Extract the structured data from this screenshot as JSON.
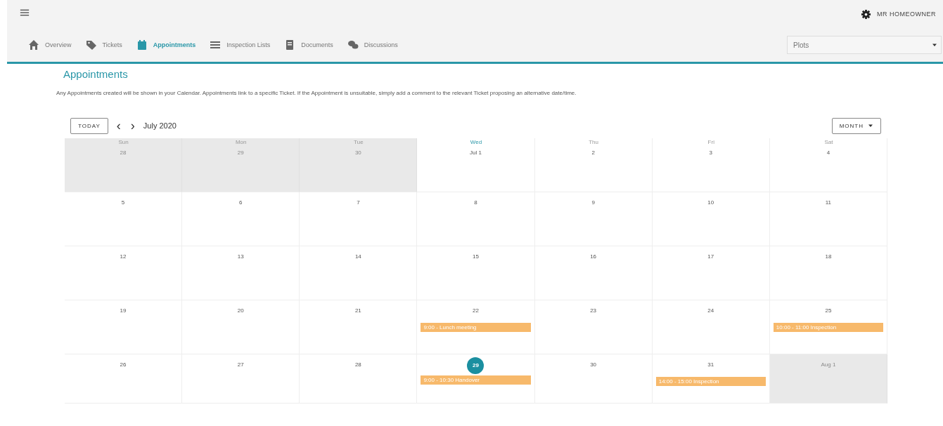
{
  "user": {
    "name": "MR HOMEOWNER"
  },
  "tabs": [
    {
      "label": "Overview",
      "selected": false
    },
    {
      "label": "Tickets",
      "selected": false
    },
    {
      "label": "Appointments",
      "selected": true
    },
    {
      "label": "Inspection Lists",
      "selected": false
    },
    {
      "label": "Documents",
      "selected": false
    },
    {
      "label": "Discussions",
      "selected": false
    }
  ],
  "plot_select": {
    "placeholder": "Plots"
  },
  "page": {
    "title": "Appointments",
    "description": "Any Appointments created will be shown in your Calendar. Appointments link to a specific Ticket. If the Appointment is unsuitable, simply add a comment to the relevant Ticket proposing an alternative date/time."
  },
  "calendar": {
    "today_button": "TODAY",
    "prev": "‹",
    "next": "›",
    "period": "July 2020",
    "view_button": "MONTH",
    "weekdays": [
      {
        "label": "Sun",
        "today": false
      },
      {
        "label": "Mon",
        "today": false
      },
      {
        "label": "Tue",
        "today": false
      },
      {
        "label": "Wed",
        "today": true
      },
      {
        "label": "Thu",
        "today": false
      },
      {
        "label": "Fri",
        "today": false
      },
      {
        "label": "Sat",
        "today": false
      }
    ],
    "weeks": [
      [
        {
          "label": "28",
          "other_month": true,
          "today": false
        },
        {
          "label": "29",
          "other_month": true,
          "today": false
        },
        {
          "label": "30",
          "other_month": true,
          "today": false
        },
        {
          "label": "Jul 1",
          "other_month": false,
          "today": false
        },
        {
          "label": "2",
          "other_month": false,
          "today": false
        },
        {
          "label": "3",
          "other_month": false,
          "today": false
        },
        {
          "label": "4",
          "other_month": false,
          "today": false
        }
      ],
      [
        {
          "label": "5",
          "other_month": false,
          "today": false
        },
        {
          "label": "6",
          "other_month": false,
          "today": false
        },
        {
          "label": "7",
          "other_month": false,
          "today": false
        },
        {
          "label": "8",
          "other_month": false,
          "today": false
        },
        {
          "label": "9",
          "other_month": false,
          "today": false
        },
        {
          "label": "10",
          "other_month": false,
          "today": false
        },
        {
          "label": "11",
          "other_month": false,
          "today": false
        }
      ],
      [
        {
          "label": "12",
          "other_month": false,
          "today": false
        },
        {
          "label": "13",
          "other_month": false,
          "today": false
        },
        {
          "label": "14",
          "other_month": false,
          "today": false
        },
        {
          "label": "15",
          "other_month": false,
          "today": false
        },
        {
          "label": "16",
          "other_month": false,
          "today": false
        },
        {
          "label": "17",
          "other_month": false,
          "today": false
        },
        {
          "label": "18",
          "other_month": false,
          "today": false
        }
      ],
      [
        {
          "label": "19",
          "other_month": false,
          "today": false
        },
        {
          "label": "20",
          "other_month": false,
          "today": false
        },
        {
          "label": "21",
          "other_month": false,
          "today": false
        },
        {
          "label": "22",
          "other_month": false,
          "today": false,
          "events": [
            {
              "text": "9:00 - Lunch meeting"
            }
          ]
        },
        {
          "label": "23",
          "other_month": false,
          "today": false
        },
        {
          "label": "24",
          "other_month": false,
          "today": false
        },
        {
          "label": "25",
          "other_month": false,
          "today": false,
          "events": [
            {
              "text": "10:00 - 11:00 Inspection"
            }
          ]
        }
      ],
      [
        {
          "label": "26",
          "other_month": false,
          "today": false
        },
        {
          "label": "27",
          "other_month": false,
          "today": false
        },
        {
          "label": "28",
          "other_month": false,
          "today": false
        },
        {
          "label": "29",
          "other_month": false,
          "today": true,
          "events": [
            {
              "text": "9:00 - 10:30 Handover"
            }
          ]
        },
        {
          "label": "30",
          "other_month": false,
          "today": false
        },
        {
          "label": "31",
          "other_month": false,
          "today": false,
          "events": [
            {
              "text": "14:00 - 15:00 Inspection"
            }
          ]
        },
        {
          "label": "Aug 1",
          "other_month": true,
          "today": false
        }
      ]
    ]
  }
}
